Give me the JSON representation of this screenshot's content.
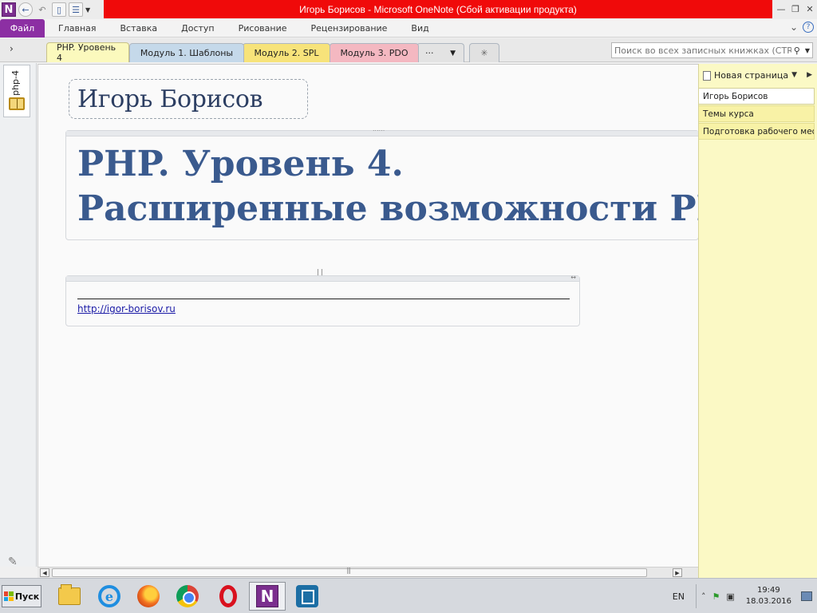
{
  "titlebar": {
    "app_logo": "N",
    "title": "Игорь Борисов  -  Microsoft OneNote (Сбой активации продукта)",
    "icons": [
      "onenote-logo-icon",
      "back-icon",
      "undo-icon",
      "dock-icon",
      "fullpage-icon",
      "customize-icon"
    ],
    "window_controls": [
      "minimize-icon",
      "restore-icon",
      "close-icon"
    ]
  },
  "ribbon": {
    "file_label": "Файл",
    "tabs": [
      "Главная",
      "Вставка",
      "Доступ",
      "Рисование",
      "Рецензирование",
      "Вид"
    ]
  },
  "sections": {
    "tabs": [
      {
        "label": "PHP. Уровень 4",
        "color": "#fbf9bd"
      },
      {
        "label": "Модуль 1. Шаблоны",
        "color": "#c5d9ea"
      },
      {
        "label": "Модуль 2. SPL",
        "color": "#f7e37a"
      },
      {
        "label": "Модуль 3. PDO",
        "color": "#f4b8c1"
      }
    ],
    "more_label": "···",
    "search_placeholder": "Поиск во всех записных книжках (CTRL+E)"
  },
  "notebook": {
    "name": "php-4"
  },
  "page": {
    "title": "Игорь Борисов",
    "heading_line1": "PHP. Уровень 4.",
    "heading_line2": "Расширенные возможности PHP",
    "link": "http://igor-borisov.ru"
  },
  "pages_pane": {
    "new_page_label": "Новая страница",
    "pages": [
      "Игорь Борисов",
      "Темы курса",
      "Подготовка рабочего мес"
    ]
  },
  "taskbar": {
    "start_label": "Пуск",
    "lang": "EN",
    "time": "19:49",
    "date": "18.03.2016",
    "onenote_letter": "N"
  },
  "colors": {
    "title_bar": "#f00a0a",
    "file_tab": "#8c2fa3",
    "heading_text": "#3a5a8e",
    "pages_pane": "#fbf9c5"
  }
}
